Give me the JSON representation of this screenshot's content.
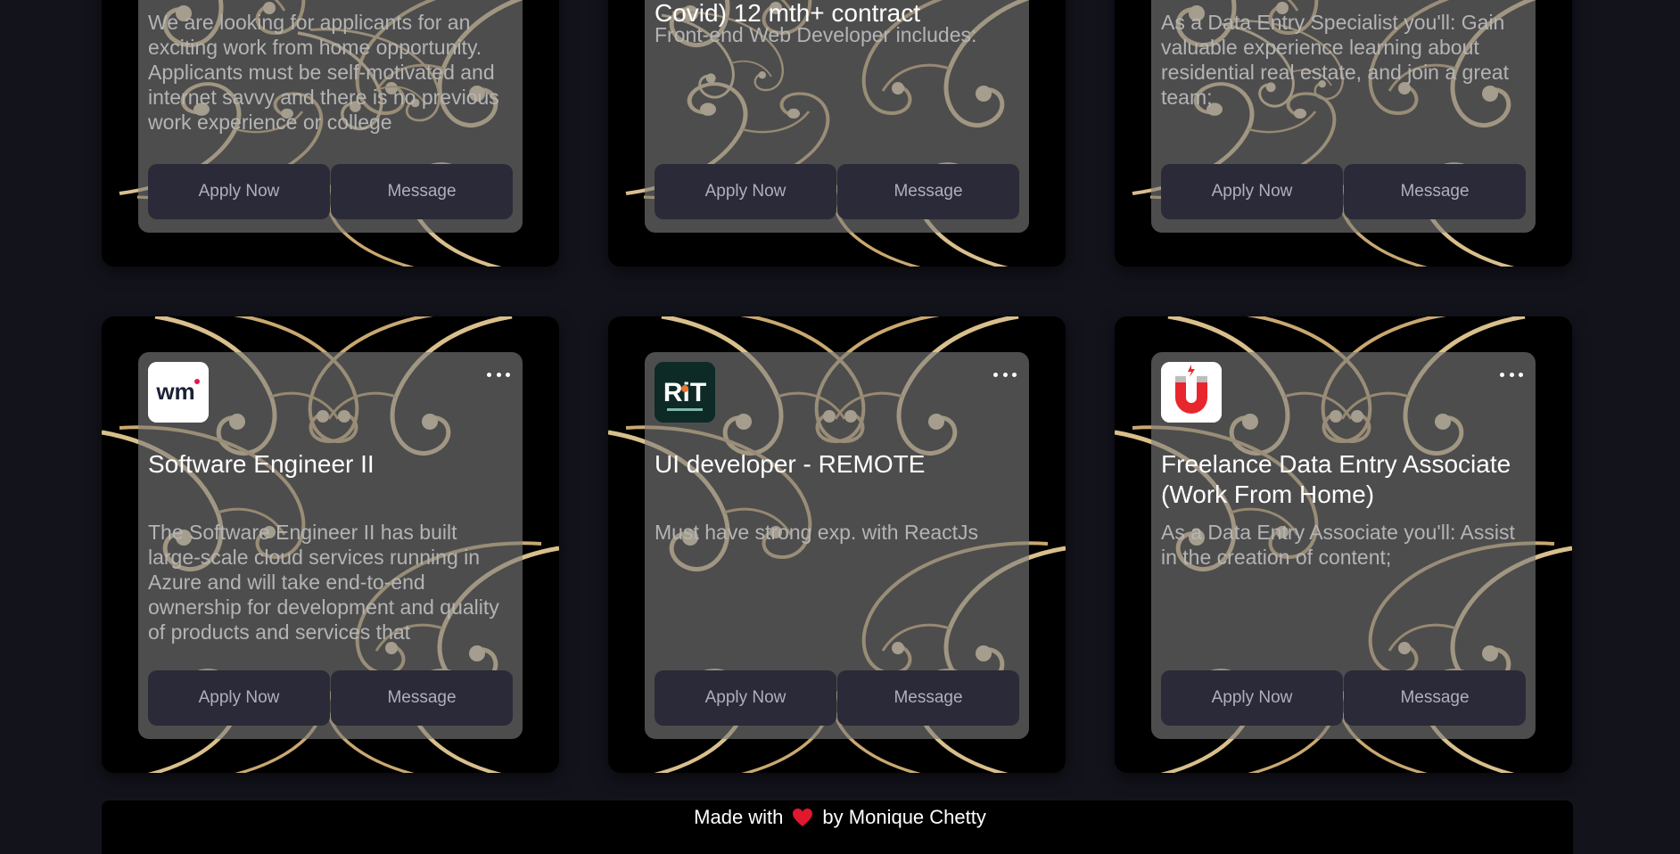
{
  "cards_top": [
    {
      "partial_title": "",
      "description": "We are looking for applicants for an exciting work from home opportunity. Applicants must be self-motivated and internet savvy and there is no previous work experience or college",
      "apply_label": "Apply Now",
      "message_label": "Message"
    },
    {
      "partial_title": "Covid) 12 mth+ contract",
      "description": "Front-end Web Developer includes:",
      "apply_label": "Apply Now",
      "message_label": "Message"
    },
    {
      "partial_title": "",
      "description": "As a Data Entry Specialist you'll: Gain valuable experience learning about residential real estate, and join a great team;",
      "apply_label": "Apply Now",
      "message_label": "Message"
    }
  ],
  "cards_bottom": [
    {
      "logo": "wm-logo",
      "logo_text": "wm",
      "title": "Software Engineer II",
      "description": "The Software Engineer II has built large-scale cloud services running in Azure and will take end-to-end ownership for development and quality of products and services that",
      "apply_label": "Apply Now",
      "message_label": "Message",
      "more_icon": "more-horizontal-icon"
    },
    {
      "logo": "rit-logo",
      "logo_text": "RiT",
      "title": "UI developer - REMOTE",
      "description": "Must have strong exp. with ReactJs",
      "apply_label": "Apply Now",
      "message_label": "Message",
      "more_icon": "more-horizontal-icon"
    },
    {
      "logo": "magnet-logo",
      "logo_text": "",
      "title": "Freelance Data Entry Associate (Work From Home)",
      "description": "As a Data Entry Associate you'll: Assist in the creation of content;",
      "apply_label": "Apply Now",
      "message_label": "Message",
      "more_icon": "more-horizontal-icon"
    }
  ],
  "footer": {
    "prefix": "Made with",
    "suffix": "by Monique Chetty",
    "heart_icon": "heart-icon",
    "heart_color": "#e0182d"
  },
  "colors": {
    "background": "#13131c",
    "card_bg": "#000000",
    "button_bg": "#2b2a38",
    "button_text": "#aeb0bc",
    "ornament": "#d9bf8c"
  }
}
